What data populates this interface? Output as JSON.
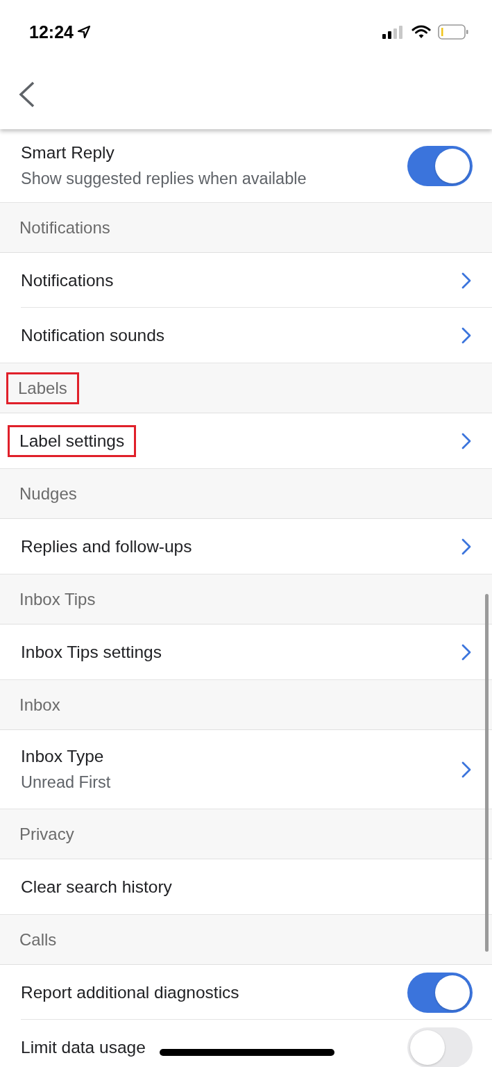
{
  "status_bar": {
    "time": "12:24"
  },
  "rows": [
    {
      "kind": "toggle",
      "title": "Smart Reply",
      "subtitle": "Show suggested replies when available",
      "on": true,
      "highlighted": false
    },
    {
      "kind": "section",
      "title": "Notifications",
      "highlighted": false
    },
    {
      "kind": "link",
      "title": "Notifications",
      "highlighted": false
    },
    {
      "kind": "link",
      "title": "Notification sounds",
      "highlighted": false
    },
    {
      "kind": "section",
      "title": "Labels",
      "highlighted": true
    },
    {
      "kind": "link",
      "title": "Label settings",
      "highlighted": true
    },
    {
      "kind": "section",
      "title": "Nudges",
      "highlighted": false
    },
    {
      "kind": "link",
      "title": "Replies and follow-ups",
      "highlighted": false
    },
    {
      "kind": "section",
      "title": "Inbox Tips",
      "highlighted": false
    },
    {
      "kind": "link",
      "title": "Inbox Tips settings",
      "highlighted": false
    },
    {
      "kind": "section",
      "title": "Inbox",
      "highlighted": false
    },
    {
      "kind": "link",
      "title": "Inbox Type",
      "subtitle": "Unread First",
      "highlighted": false
    },
    {
      "kind": "section",
      "title": "Privacy",
      "highlighted": false
    },
    {
      "kind": "plain",
      "title": "Clear search history",
      "highlighted": false
    },
    {
      "kind": "section",
      "title": "Calls",
      "highlighted": false
    },
    {
      "kind": "toggle",
      "title": "Report additional diagnostics",
      "on": true,
      "highlighted": false
    },
    {
      "kind": "toggle",
      "title": "Limit data usage",
      "on": false,
      "highlighted": false
    }
  ]
}
